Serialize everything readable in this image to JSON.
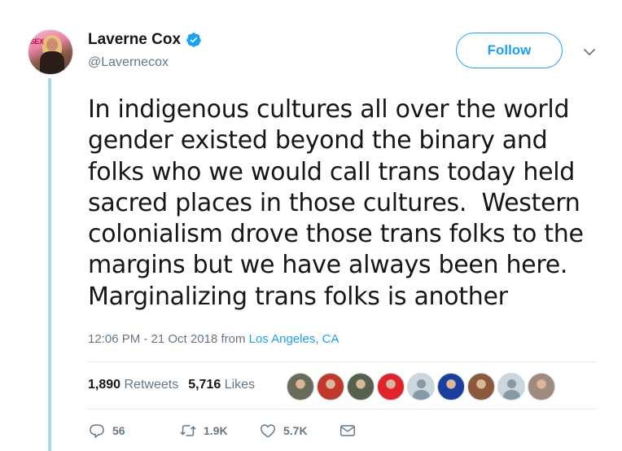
{
  "author": {
    "name": "Laverne Cox",
    "handle": "@Lavernecox",
    "avatar_magazine_text": "SEX"
  },
  "follow_button": {
    "label": "Follow"
  },
  "tweet": {
    "lines": [
      "In indigenous cultures all over the world",
      "gender existed beyond the binary and",
      "folks who we would call trans today held",
      "sacred places in those cultures.  Western",
      "colonialism drove those trans folks to the",
      "margins but we have always been here.",
      "Marginalizing trans folks is another"
    ],
    "timestamp": "12:06 PM - 21 Oct 2018",
    "from_label": "from",
    "location": "Los Angeles, CA"
  },
  "stats": {
    "retweets_count": "1,890",
    "retweets_label": "Retweets",
    "likes_count": "5,716",
    "likes_label": "Likes"
  },
  "likers": [
    {
      "name": "liker-1",
      "color": "#6b6b5a"
    },
    {
      "name": "liker-2",
      "color": "#c0392b"
    },
    {
      "name": "liker-3",
      "color": "#55604f"
    },
    {
      "name": "liker-4",
      "color": "#e0242b"
    },
    {
      "name": "liker-5",
      "color": "default"
    },
    {
      "name": "liker-6",
      "color": "#1a3f9e"
    },
    {
      "name": "liker-7",
      "color": "#8b5a3c"
    },
    {
      "name": "liker-8",
      "color": "default"
    },
    {
      "name": "liker-9",
      "color": "#a08a80"
    }
  ],
  "actions": {
    "replies": "56",
    "retweets": "1.9K",
    "likes": "5.7K"
  },
  "colors": {
    "accent": "#1da1f2",
    "secondary_text": "#657786",
    "thread_line": "#a8d7ea"
  }
}
